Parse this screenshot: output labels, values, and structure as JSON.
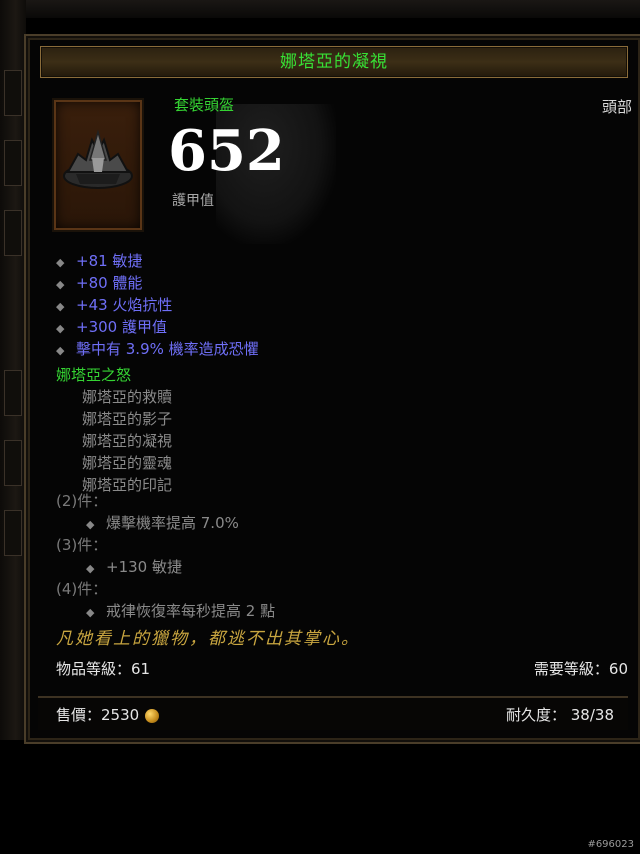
{
  "item": {
    "name": "娜塔亞的凝視",
    "type": "套裝頭盔",
    "slot": "頭部",
    "armor_value": "652",
    "armor_label": "護甲值",
    "stats": [
      "+81 敏捷",
      "+80 體能",
      "+43 火焰抗性",
      "+300 護甲值",
      "擊中有 3.9% 機率造成恐懼"
    ],
    "set": {
      "name": "娜塔亞之怒",
      "items": [
        "娜塔亞的救贖",
        "娜塔亞的影子",
        "娜塔亞的凝視",
        "娜塔亞的靈魂",
        "娜塔亞的印記"
      ],
      "bonuses": [
        {
          "pieces": "(2)件：",
          "text": "爆擊機率提高 7.0%"
        },
        {
          "pieces": "(3)件：",
          "text": "+130 敏捷"
        },
        {
          "pieces": "(4)件：",
          "text": "戒律恢復率每秒提高 2 點"
        }
      ]
    },
    "flavor": "凡她看上的獵物，都逃不出其掌心。",
    "item_level": "物品等級：61",
    "required_level": "需要等級：60",
    "sell_value": "售價：2530",
    "durability": "耐久度： 38/38"
  },
  "watermark": "#696023",
  "colors": {
    "name_green": "#37e035",
    "magic_blue": "#6f6ff7",
    "flavor_gold": "#c9a640",
    "frame_brown": "#4a3d29"
  },
  "icons": [
    "helm-icon",
    "diamond-bullet-icon",
    "gold-coin-icon"
  ]
}
